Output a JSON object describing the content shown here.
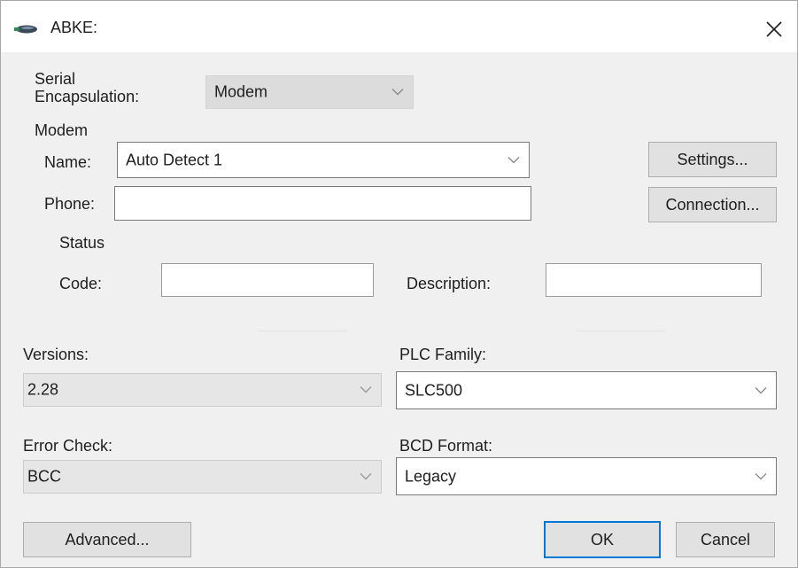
{
  "window": {
    "title": "ABKE:",
    "icons": {
      "app": "network-card-icon",
      "close": "close-icon"
    }
  },
  "serial": {
    "label": "Serial Encapsulation:",
    "value": "Modem"
  },
  "modem": {
    "group_label": "Modem",
    "name_label": "Name:",
    "name_value": "Auto Detect 1",
    "phone_label": "Phone:",
    "phone_value": "",
    "settings_button": "Settings...",
    "connection_button": "Connection...",
    "status": {
      "group_label": "Status",
      "code_label": "Code:",
      "code_value": "",
      "description_label": "Description:",
      "description_value": ""
    }
  },
  "versions": {
    "label": "Versions:",
    "value": "2.28"
  },
  "plc_family": {
    "label": "PLC Family:",
    "value": "SLC500"
  },
  "error_check": {
    "label": "Error Check:",
    "value": "BCC"
  },
  "bcd_format": {
    "label": "BCD Format:",
    "value": "Legacy"
  },
  "footer": {
    "advanced_button": "Advanced...",
    "ok_button": "OK",
    "cancel_button": "Cancel"
  },
  "colors": {
    "dialog_bg": "#f0f0f0",
    "default_button_border": "#0078d7"
  }
}
